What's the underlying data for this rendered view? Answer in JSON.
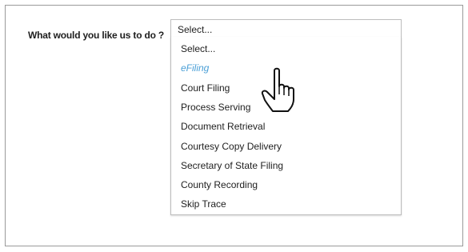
{
  "form": {
    "question": "What would you like us to do ?",
    "select_value": "Select..."
  },
  "dropdown": {
    "options": [
      "Select...",
      "eFiling",
      "Court Filing",
      "Process Serving",
      "Document Retrieval",
      "Courtesy Copy Delivery",
      "Secretary of State Filing",
      "County Recording",
      "Skip Trace"
    ],
    "highlighted_option": "eFiling",
    "highlight_color": "#4a9fd6"
  },
  "cursor": {
    "icon": "hand-pointer-icon"
  }
}
